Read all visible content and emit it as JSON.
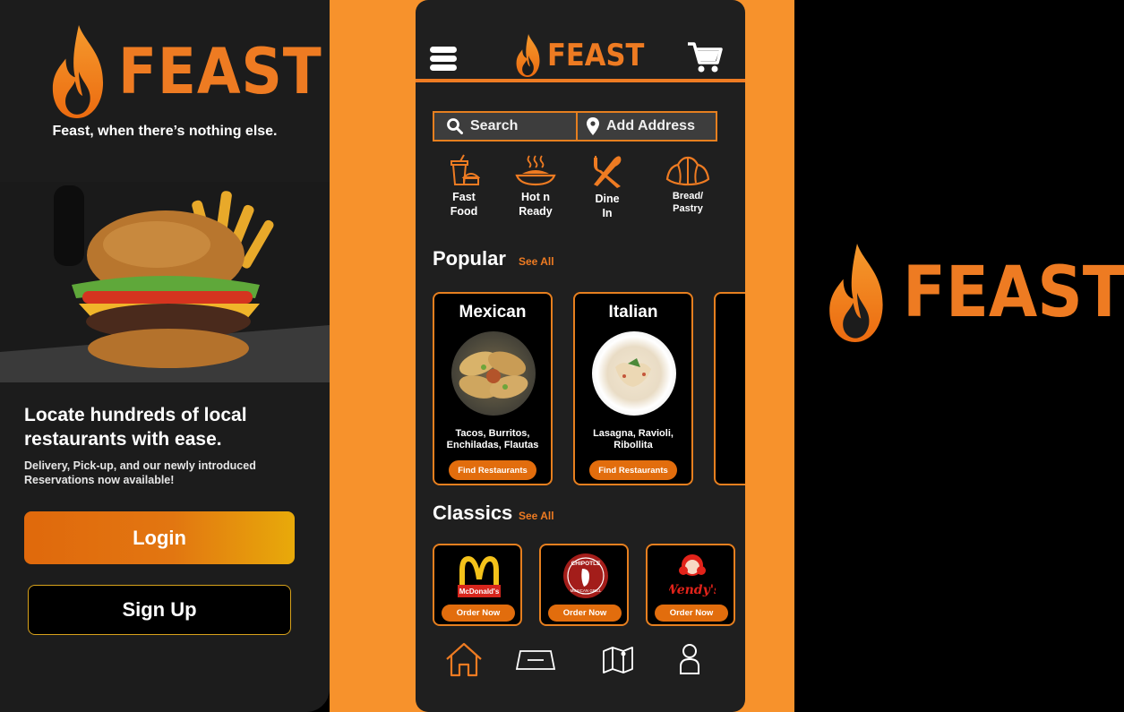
{
  "brand": {
    "name": "FEAST",
    "tagline": "Feast, when there’s nothing else.",
    "accent": "#ee7b22"
  },
  "onboarding": {
    "headline": "Locate hundreds of local restaurants with ease.",
    "subtext": "Delivery, Pick-up, and our newly introduced Reservations now available!",
    "login_label": "Login",
    "signup_label": "Sign Up"
  },
  "home": {
    "search_placeholder": "Search",
    "address_placeholder": "Add Address",
    "categories": [
      {
        "label": "Fast\nFood",
        "icon": "fast-food-icon"
      },
      {
        "label": "Hot n\nReady",
        "icon": "hot-dish-icon"
      },
      {
        "label": "Dine\nIn",
        "icon": "fork-knife-icon"
      },
      {
        "label": "Bread/\nPastry",
        "icon": "croissant-icon"
      }
    ],
    "popular": {
      "title": "Popular",
      "see_all": "See All",
      "cards": [
        {
          "title": "Mexican",
          "desc": "Tacos, Burritos, Enchiladas, Flautas",
          "button": "Find Restaurants"
        },
        {
          "title": "Italian",
          "desc": "Lasagna, Ravioli, Ribollita",
          "button": "Find Restaurants"
        }
      ]
    },
    "classics": {
      "title": "Classics",
      "see_all": "See All",
      "cards": [
        {
          "brand_text": "McDonald's",
          "button": "Order Now"
        },
        {
          "brand_text": "CHIPOTLE",
          "brand_sub": "MEXICAN GRILL",
          "button": "Order Now"
        },
        {
          "brand_text": "Wendy's",
          "button": "Order Now"
        }
      ]
    },
    "tabs": [
      "home-icon",
      "ticket-icon",
      "map-icon",
      "profile-icon"
    ]
  }
}
